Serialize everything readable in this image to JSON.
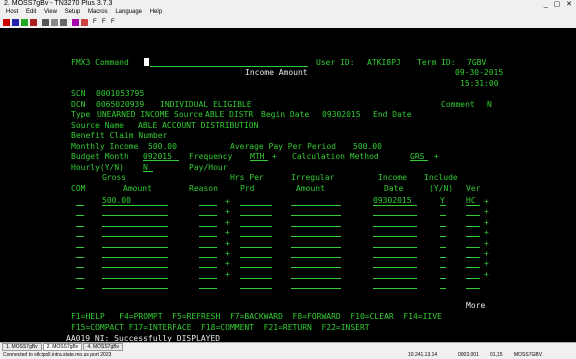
{
  "window": {
    "title": "2. MOSS7gBv - TN3270 Plus 3.7.3",
    "controls": "_ ▢ ✕"
  },
  "menu": [
    "Host",
    "Edit",
    "View",
    "Setup",
    "Macros",
    "Language",
    "Help"
  ],
  "toolbar_icons": [
    "connect-icon",
    "disconnect-icon",
    "receive-icon",
    "send-icon",
    "print-icon",
    "copy-icon",
    "paste-icon",
    "keyboard-icon",
    "grid-icon",
    "F-key-icon",
    "F-key-icon",
    "F-key-icon"
  ],
  "screen": {
    "command_label": "FMX3 Command",
    "user_id_label": "User ID:",
    "user_id": "ATKI8PJ",
    "term_id_label": "Term ID:",
    "term_id": "7GBV",
    "title": "Income Amount",
    "date": "09-30-2015",
    "time": "15:31:00",
    "scn_label": "SCN",
    "scn": "0001053795",
    "dcn_label": "DCN",
    "dcn": "0065020939",
    "status": "INDIVIDUAL ELIGIBLE",
    "comment_label": "Comment",
    "comment": "N",
    "type_label": "Type",
    "type": "UNEARNED INCOME",
    "source_label": "Source",
    "source": "ABLE DISTR",
    "begin_label": "Begin Date",
    "begin_date": "09302015",
    "end_label": "End Date",
    "source_name_label": "Source Name",
    "source_name": "ABLE ACCOUNT DISTRIBUTION",
    "benefit_label": "Benefit Claim Number",
    "monthly_label": "Monthly Income",
    "monthly": "500.00",
    "avg_label": "Average Pay Per Period",
    "avg": "500.00",
    "budget_label": "Budget Month",
    "budget_month": "092015",
    "freq_label": "Frequency",
    "frequency": "MTH",
    "calc_label": "Calculation Method",
    "calc_method": "GRS",
    "hourly_label": "Hourly(Y/N)",
    "hourly": "N",
    "payhour_label": "Pay/Hour",
    "plus": "+",
    "headers": {
      "gross": "Gross",
      "hrs_per": "Hrs Per",
      "irregular": "Irregular",
      "income": "Income",
      "include": "Include",
      "com": "COM",
      "amount": "Amount",
      "reason": "Reason",
      "prd": "Prd",
      "amount2": "Amount",
      "date": "Date",
      "yn": "(Y/N)",
      "ver": "Ver"
    },
    "row1": {
      "amount": "500.00",
      "date": "09302015",
      "include": "Y",
      "ver": "HC"
    },
    "more": "More",
    "fkeys1": "F1=HELP   F4=PROMPT  F5=REFRESH  F7=BACKWARD  F8=FORWARD  F10=CLEAR  F14=IIVE",
    "fkeys2": "F15=COMPACT F17=INTERFACE  F18=COMMENT  F21=RETURN  F22=INSERT",
    "message": "AA019_NI: Successfully DISPLAYED"
  },
  "statusbar": {
    "tabs": [
      "1. MOSS7gBv",
      "2. MOSS7gBv",
      "4. MOSS7gBv"
    ],
    "connection": "Connected to stlcipoll.intra.state.mo.us port 2023",
    "ip": "10.241.13.14",
    "pos": "0003.001",
    "num": "01,15",
    "session": "MOSS7GBV"
  }
}
